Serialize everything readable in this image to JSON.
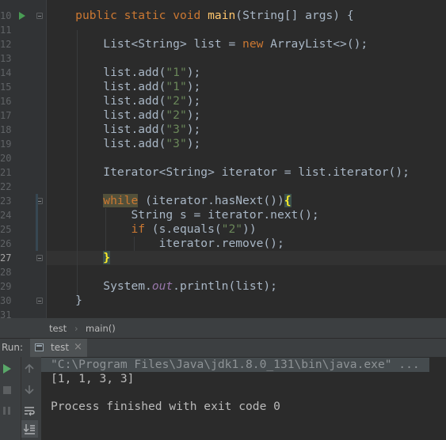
{
  "editor": {
    "line_numbers": [
      "10",
      "11",
      "12",
      "13",
      "14",
      "15",
      "16",
      "17",
      "18",
      "19",
      "20",
      "21",
      "22",
      "23",
      "24",
      "25",
      "26",
      "27",
      "28",
      "29",
      "30",
      "31"
    ],
    "code": {
      "l10": [
        "public",
        "static",
        "void",
        "main",
        "(String[] args) {"
      ],
      "l12": [
        "List<String> list = ",
        "new",
        " ArrayList<>();"
      ],
      "adds": [
        {
          "pre": "list.add(",
          "arg": "\"1\"",
          "post": ");"
        },
        {
          "pre": "list.add(",
          "arg": "\"1\"",
          "post": ");"
        },
        {
          "pre": "list.add(",
          "arg": "\"2\"",
          "post": ");"
        },
        {
          "pre": "list.add(",
          "arg": "\"2\"",
          "post": ");"
        },
        {
          "pre": "list.add(",
          "arg": "\"3\"",
          "post": ");"
        },
        {
          "pre": "list.add(",
          "arg": "\"3\"",
          "post": ");"
        }
      ],
      "l21": "Iterator<String> iterator = list.iterator();",
      "l23": [
        "while",
        " (iterator.hasNext())",
        "{"
      ],
      "l24": "String s = iterator.next();",
      "l25": [
        "if",
        " (s.equals(",
        "\"2\"",
        "))"
      ],
      "l26": "iterator.remove();",
      "l27": "}",
      "l29": [
        "System.",
        "out",
        ".println(list);"
      ],
      "l30": "}"
    }
  },
  "breadcrumb": {
    "items": [
      "test",
      "main()"
    ],
    "separator": "›"
  },
  "run_panel": {
    "label": "Run:",
    "tab_label": "test",
    "tab_close": "×",
    "console_lines": [
      "\"C:\\Program Files\\Java\\jdk1.8.0_131\\bin\\java.exe\" ...",
      "[1, 1, 3, 3]",
      "",
      "Process finished with exit code 0"
    ]
  },
  "colors": {
    "keyword": "#cc7832",
    "method_decl": "#ffc66d",
    "string": "#6a8759",
    "static_field": "#9876aa",
    "default_text": "#a9b7c6"
  }
}
